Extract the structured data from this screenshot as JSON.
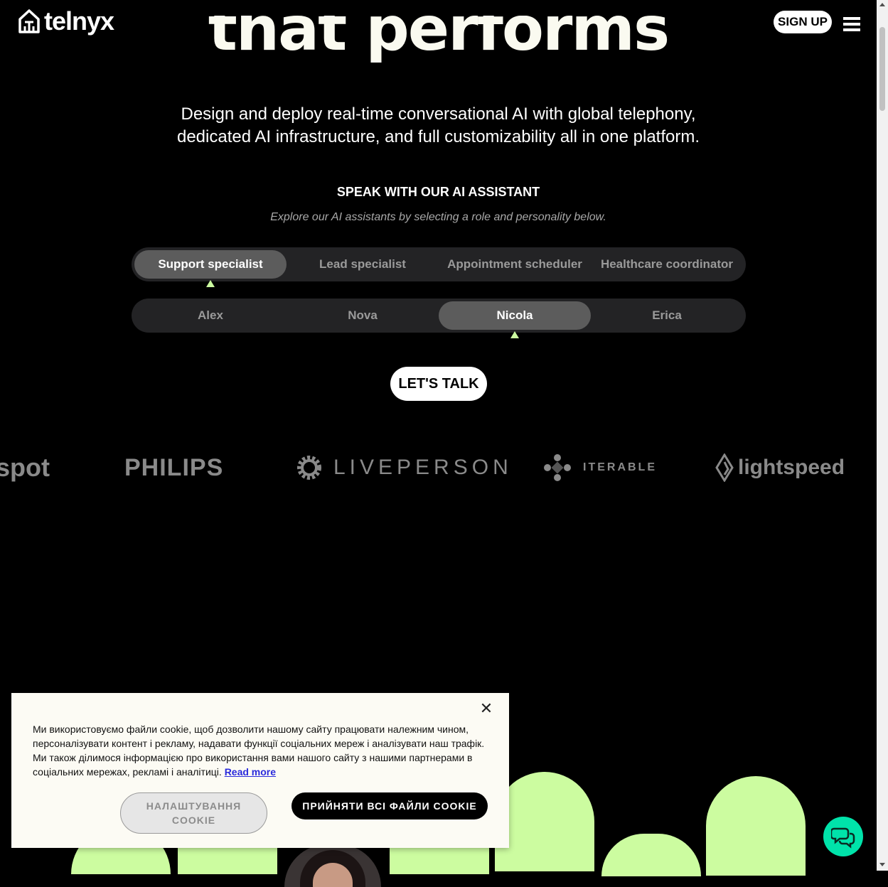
{
  "header": {
    "logo_text": "telnyx",
    "signup_label": "SIGN UP",
    "menu_icon": "hamburger-menu-icon"
  },
  "hero": {
    "headline": "that performs",
    "subtitle_line1": "Design and deploy real-time conversational AI with global telephony,",
    "subtitle_line2": "dedicated AI infrastructure, and full customizability all in one platform."
  },
  "assistant": {
    "title": "SPEAK WITH OUR AI ASSISTANT",
    "subtitle": "Explore our AI assistants by selecting a role and personality below.",
    "roles": [
      "Support specialist",
      "Lead specialist",
      "Appointment scheduler",
      "Healthcare coordinator"
    ],
    "selected_role": "Support specialist",
    "voices": [
      "Alex",
      "Nova",
      "Nicola",
      "Erica"
    ],
    "selected_voice": "Nicola",
    "cta_label": "LET'S TALK",
    "accent_color": "#ccfca0"
  },
  "brands": [
    "spot",
    "PHILIPS",
    "LIVEPERSON",
    "ITERABLE",
    "lightspeed"
  ],
  "cookie": {
    "text": "Ми використовуємо файли cookie, щоб дозволити нашому сайту працювати належним чином, персоналізувати контент і рекламу, надавати функції соціальних мереж і аналізувати наш трафік. Ми також ділимося інформацією про використання вами нашого сайту з нашими партнерами в соціальних мережах, рекламі і аналітиці.",
    "read_more": "Read more",
    "settings_label": "НАЛАШТУВАННЯ COOKIE",
    "accept_label": "ПРИЙНЯТИ ВСІ ФАЙЛИ COOKIE",
    "close_icon": "close-icon"
  },
  "chat": {
    "icon": "chat-bubbles-icon",
    "color": "#00e3aa"
  }
}
